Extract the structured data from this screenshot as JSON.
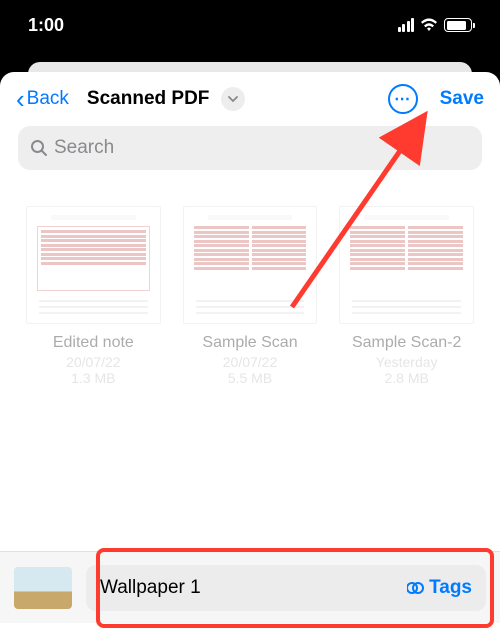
{
  "status": {
    "time": "1:00"
  },
  "nav": {
    "back": "Back",
    "title": "Scanned PDF",
    "save": "Save"
  },
  "search": {
    "placeholder": "Search"
  },
  "files": [
    {
      "name": "Edited note",
      "date": "20/07/22",
      "size": "1.3 MB"
    },
    {
      "name": "Sample Scan",
      "date": "20/07/22",
      "size": "5.5 MB"
    },
    {
      "name": "Sample Scan-2",
      "date": "Yesterday",
      "size": "2.8 MB"
    }
  ],
  "rename": {
    "value": "Wallpaper 1",
    "tags": "Tags"
  },
  "colors": {
    "accent": "#007AFF",
    "highlight": "#FF3B30"
  }
}
